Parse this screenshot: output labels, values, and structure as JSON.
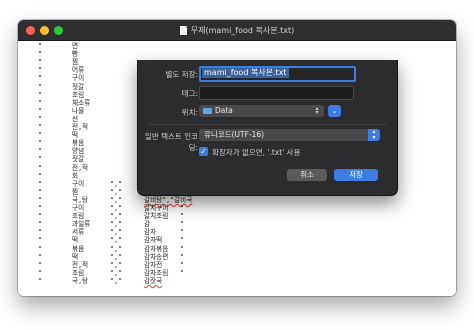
{
  "window": {
    "title": "무제(mami_food 복사본.txt)"
  },
  "save_sheet": {
    "save_as_label": "별도 저장:",
    "filename_value": "mami_food 복사본.txt",
    "tags_label": "태그:",
    "tags_value": "",
    "location_label": "위치:",
    "location_value": "Data",
    "location_icon": "folder-icon",
    "encoding_label": "일반 텍스트 인코딩:",
    "encoding_value": "유니코드(UTF-16)",
    "extension_checkbox_label": "확장자가 없으면, '.txt' 사용",
    "extension_checkbox_checked": true,
    "cancel_label": "취소",
    "save_label": "저장",
    "accent_color": "#3d7ce0"
  },
  "editor": {
    "lines": [
      [
        "\"",
        "면",
        "",
        "",
        ""
      ],
      [
        "\"",
        "빵",
        "",
        "",
        ""
      ],
      [
        "\"",
        "찜",
        "",
        "",
        ""
      ],
      [
        "\"",
        "어류",
        "",
        "",
        ""
      ],
      [
        "\"",
        "구이",
        "",
        "",
        ""
      ],
      [
        "\"",
        "젓갈",
        "",
        "",
        ""
      ],
      [
        "\"",
        "조림",
        "",
        "",
        ""
      ],
      [
        "\"",
        "채소류",
        "",
        "",
        ""
      ],
      [
        "\"",
        "나물",
        "",
        "",
        ""
      ],
      [
        "\"",
        "선",
        "",
        "",
        ""
      ],
      [
        "\"",
        "전,적",
        "",
        "",
        ""
      ],
      [
        "\"",
        "떡",
        "",
        "",
        ""
      ],
      [
        "\"",
        "볶음",
        "",
        "",
        ""
      ],
      [
        "\"",
        "양념",
        "",
        "",
        ""
      ],
      [
        "\"",
        "젓갈",
        "",
        "",
        ""
      ],
      [
        "\"",
        "전,적",
        "",
        "",
        ""
      ],
      [
        "\"",
        "회",
        "",
        "",
        ""
      ],
      [
        "\"",
        "구이",
        "\",\"",
        "갈비구이",
        "\""
      ],
      [
        "\"",
        "찜",
        "\",\"",
        "갈비찜",
        "\""
      ],
      [
        "\"",
        "국,탕",
        "\",\"",
        "갈비탕\",\"갈비국",
        ""
      ],
      [
        "\"",
        "구이",
        "\",\"",
        "갈치구이",
        "\""
      ],
      [
        "\"",
        "조림",
        "\",\"",
        "갈치조림",
        "\""
      ],
      [
        "\"",
        "과일류",
        "\",\"",
        "감",
        "\""
      ],
      [
        "\"",
        "서류",
        "\",\"",
        "감자",
        "\""
      ],
      [
        "\"",
        "떡",
        "\",\"",
        "감자떡",
        "\""
      ],
      [
        "\"",
        "볶음",
        "\",\"",
        "감자볶음",
        "\""
      ],
      [
        "\"",
        "떡",
        "\",\"",
        "감자송편",
        "\""
      ],
      [
        "\"",
        "전,적",
        "\",\"",
        "감자전",
        "\""
      ],
      [
        "\"",
        "조림",
        "\",\"",
        "감자조림",
        "\""
      ],
      [
        "\"",
        "국,탕",
        "\",\"",
        "감잣국",
        ""
      ]
    ]
  }
}
